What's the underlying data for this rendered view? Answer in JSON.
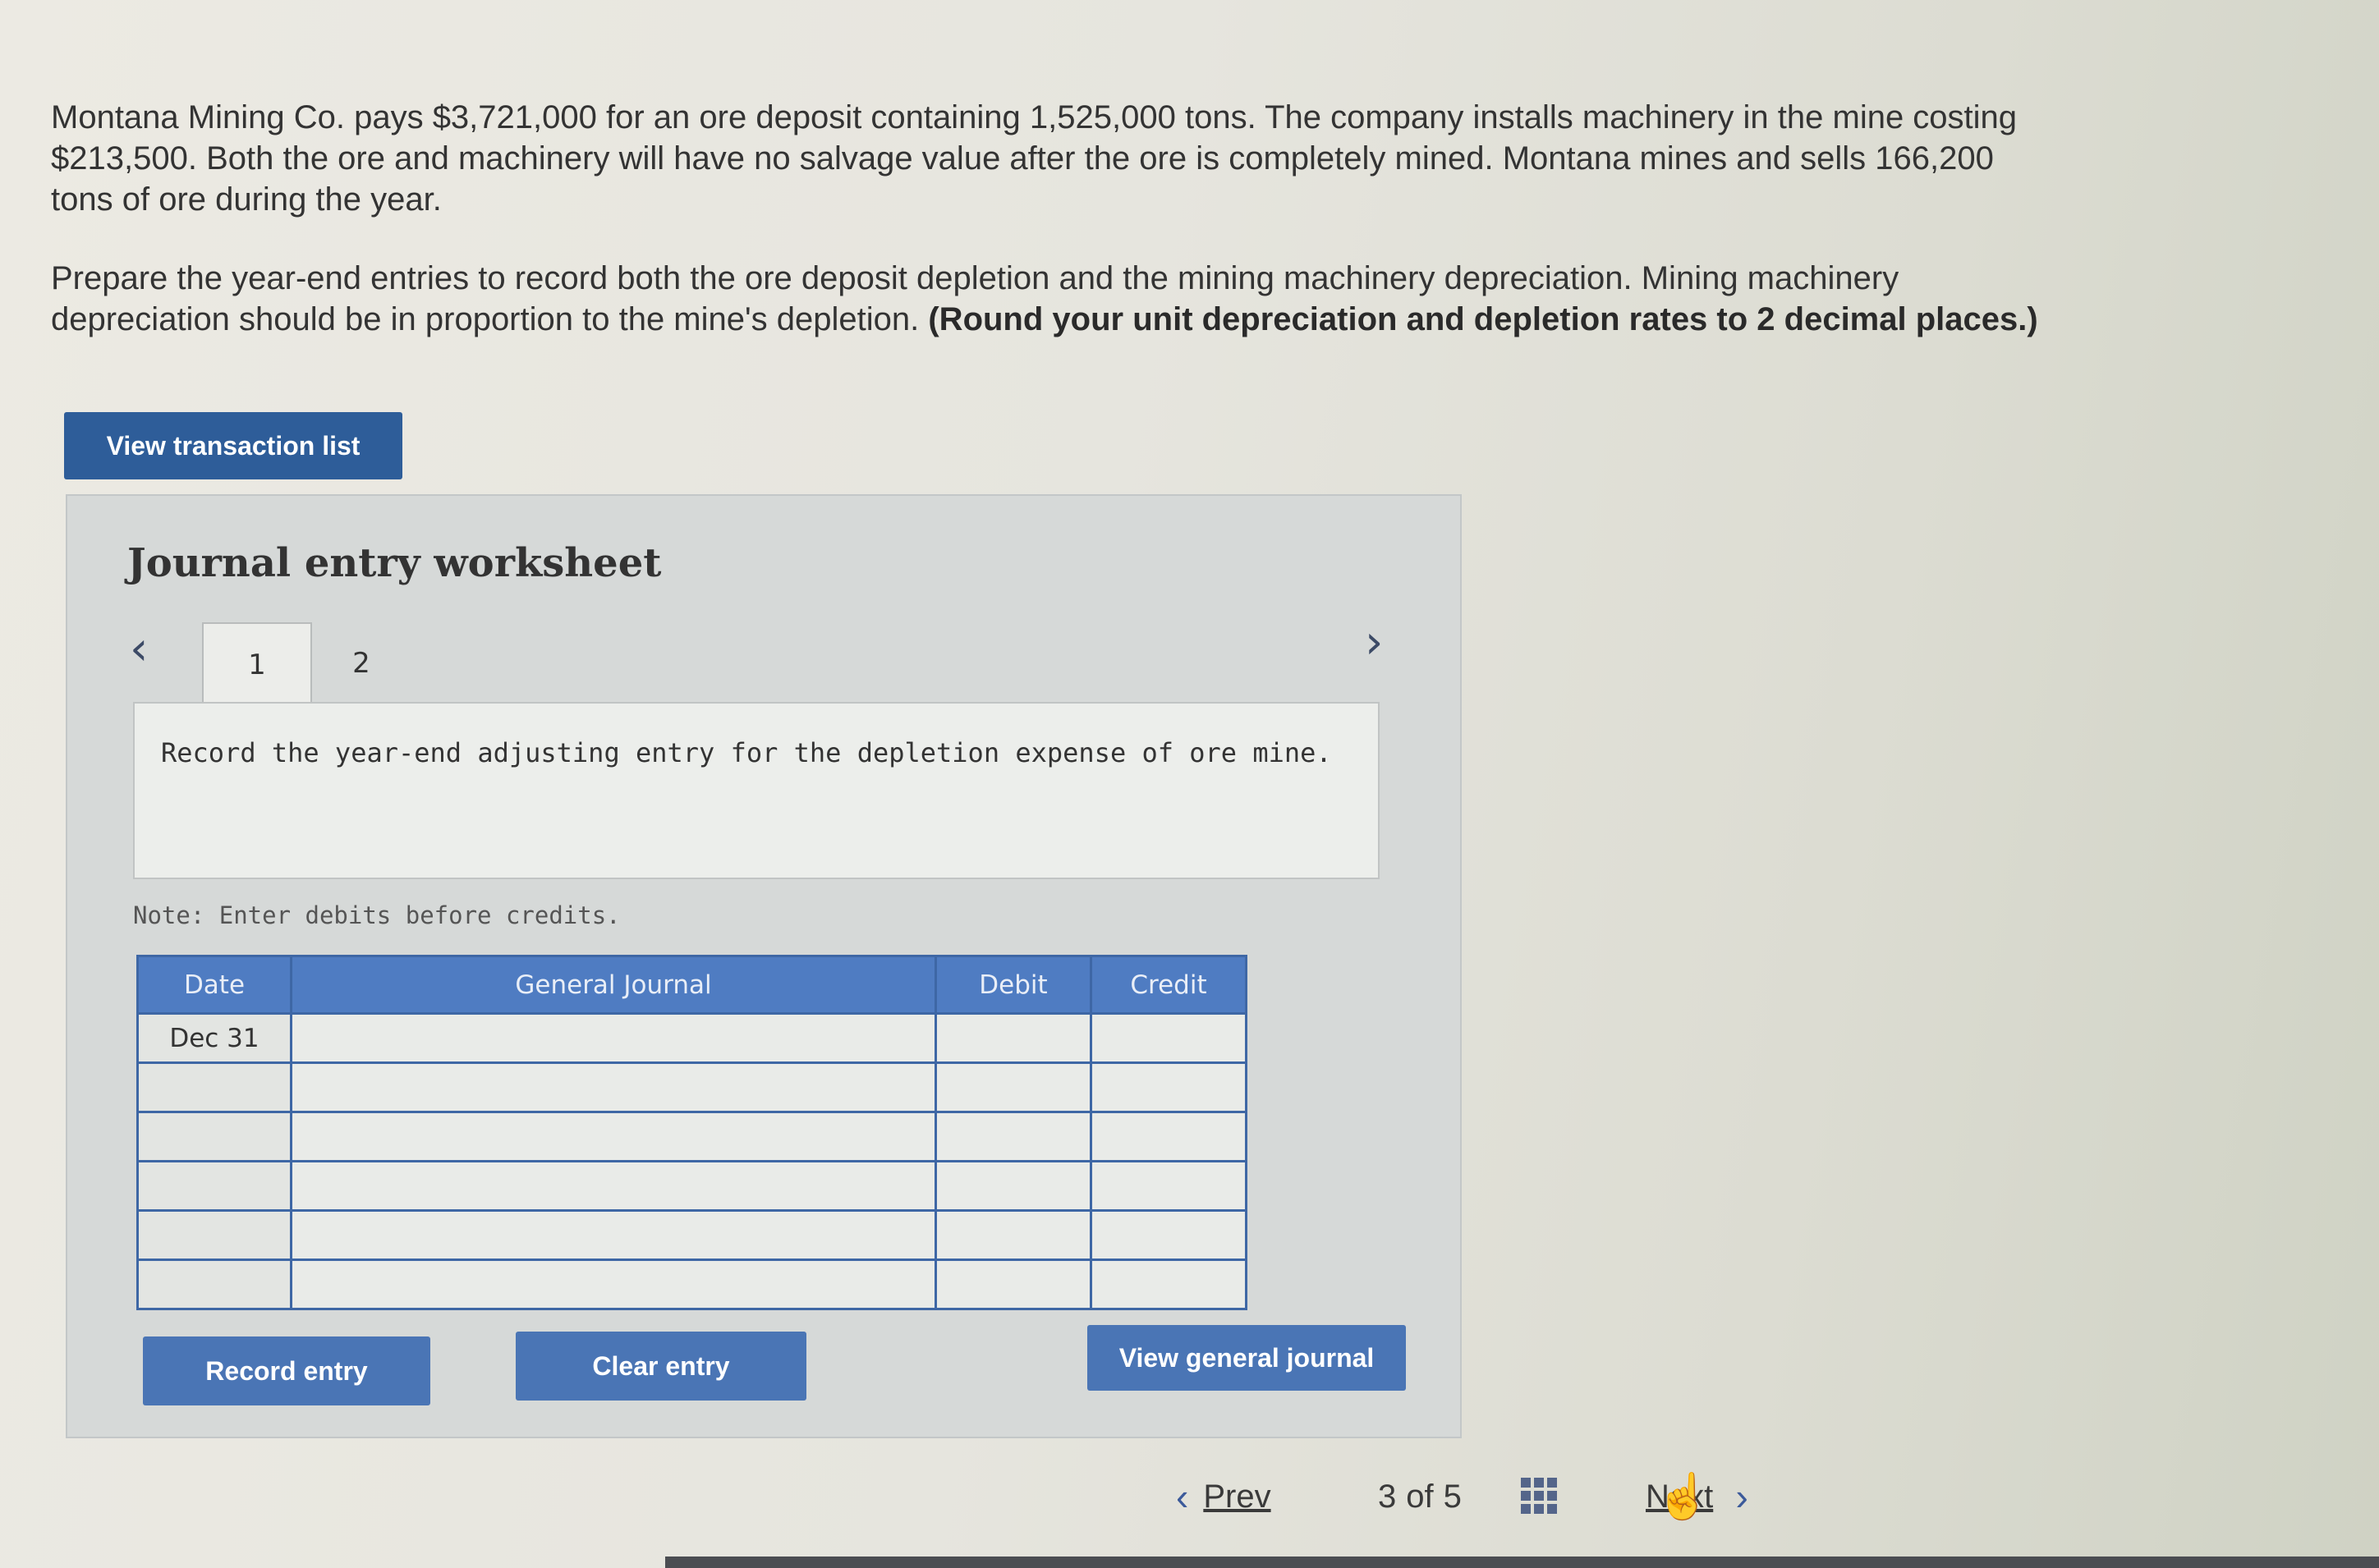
{
  "problem": {
    "paragraph1": "Montana Mining Co. pays $3,721,000 for an ore deposit containing 1,525,000 tons. The company installs machinery in the mine costing $213,500. Both the ore and machinery will have no salvage value after the ore is completely mined. Montana mines and sells 166,200 tons of ore during the year.",
    "paragraph2_text": "Prepare the year-end entries to record both the ore deposit depletion and the mining machinery depreciation. Mining machinery depreciation should be in proportion to the mine's depletion.",
    "paragraph2_bold": "(Round your unit depreciation and depletion rates to 2 decimal places.)"
  },
  "buttons": {
    "view_transaction_list": "View transaction list",
    "record_entry": "Record entry",
    "clear_entry": "Clear entry",
    "view_general_journal": "View general journal"
  },
  "worksheet": {
    "title": "Journal entry worksheet",
    "tabs": [
      "1",
      "2"
    ],
    "active_tab": "1",
    "instruction": "Record the year-end adjusting entry for the depletion expense of ore mine.",
    "note": "Note: Enter debits before credits."
  },
  "journal": {
    "headers": {
      "date": "Date",
      "general_journal": "General Journal",
      "debit": "Debit",
      "credit": "Credit"
    },
    "rows": [
      {
        "date": "Dec 31",
        "account": "",
        "debit": "",
        "credit": ""
      },
      {
        "date": "",
        "account": "",
        "debit": "",
        "credit": ""
      },
      {
        "date": "",
        "account": "",
        "debit": "",
        "credit": ""
      },
      {
        "date": "",
        "account": "",
        "debit": "",
        "credit": ""
      },
      {
        "date": "",
        "account": "",
        "debit": "",
        "credit": ""
      },
      {
        "date": "",
        "account": "",
        "debit": "",
        "credit": ""
      }
    ]
  },
  "pagination": {
    "prev": "Prev",
    "current": "3",
    "of": "of",
    "total": "5",
    "next": "Next"
  },
  "colors": {
    "button": "#4a75b5",
    "table_header": "#4f7cc2",
    "table_border": "#3e67a5"
  },
  "icons": [
    "chevron-left-icon",
    "chevron-right-icon",
    "grid-icon",
    "hand-cursor-icon"
  ]
}
